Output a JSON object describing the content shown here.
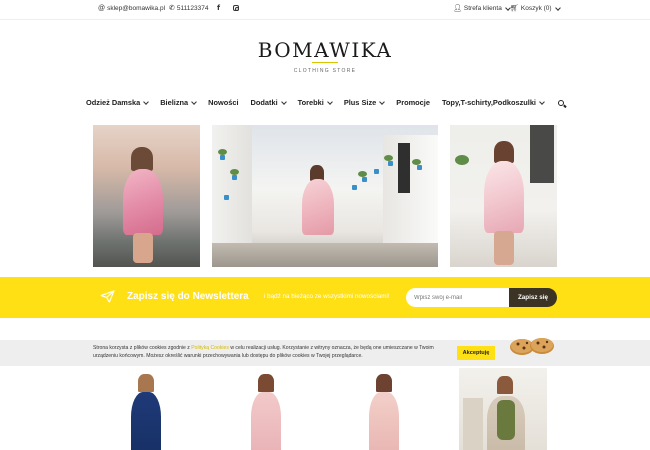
{
  "topbar": {
    "email": "sklep@bomawika.pl",
    "phone": "511123374",
    "account": "Strefa klienta",
    "cart": "Koszyk (0)"
  },
  "logo": {
    "title": "BOMAWIKA",
    "subtitle": "CLOTHING STORE"
  },
  "nav": {
    "items": [
      {
        "label": "Odzież Damska",
        "dropdown": true
      },
      {
        "label": "Bielizna",
        "dropdown": true
      },
      {
        "label": "Nowości",
        "dropdown": false
      },
      {
        "label": "Dodatki",
        "dropdown": true
      },
      {
        "label": "Torebki",
        "dropdown": true
      },
      {
        "label": "Plus Size",
        "dropdown": true
      },
      {
        "label": "Promocje",
        "dropdown": false
      },
      {
        "label": "Topy,T-schirty,Podkoszulki",
        "dropdown": true
      }
    ]
  },
  "newsletter": {
    "title": "Zapisz się do Newslettera",
    "subtitle": "i bądź na bieżąco ze wszystkimi nowościami!",
    "input_placeholder": "Wpisz swój e-mail",
    "button_label": "Zapisz się",
    "bg_color": "#ffe015"
  },
  "cookie": {
    "text_before_link": "Strona korzysta z plików cookies zgodnie z ",
    "link_text": "Polityką Cookies",
    "text_after_link": " w celu realizacji usług. Korzystanie z witryny oznacza, że będą one umieszczane w Twoim urządzeniu końcowym. Możesz określić warunki przechowywania lub dostępu do plików cookies w Twojej przeglądarce.",
    "accept_label": "Akceptuję"
  },
  "colors": {
    "accent": "#ffe015",
    "button_dark": "#3b3425",
    "cookie_bg": "#eeeeee"
  },
  "icons": {
    "email": "envelope-icon",
    "phone": "phone-icon",
    "facebook": "facebook-icon",
    "instagram": "instagram-icon",
    "account": "user-icon",
    "cart": "basket-icon",
    "search": "search-icon",
    "newsletter": "paper-plane-icon"
  }
}
